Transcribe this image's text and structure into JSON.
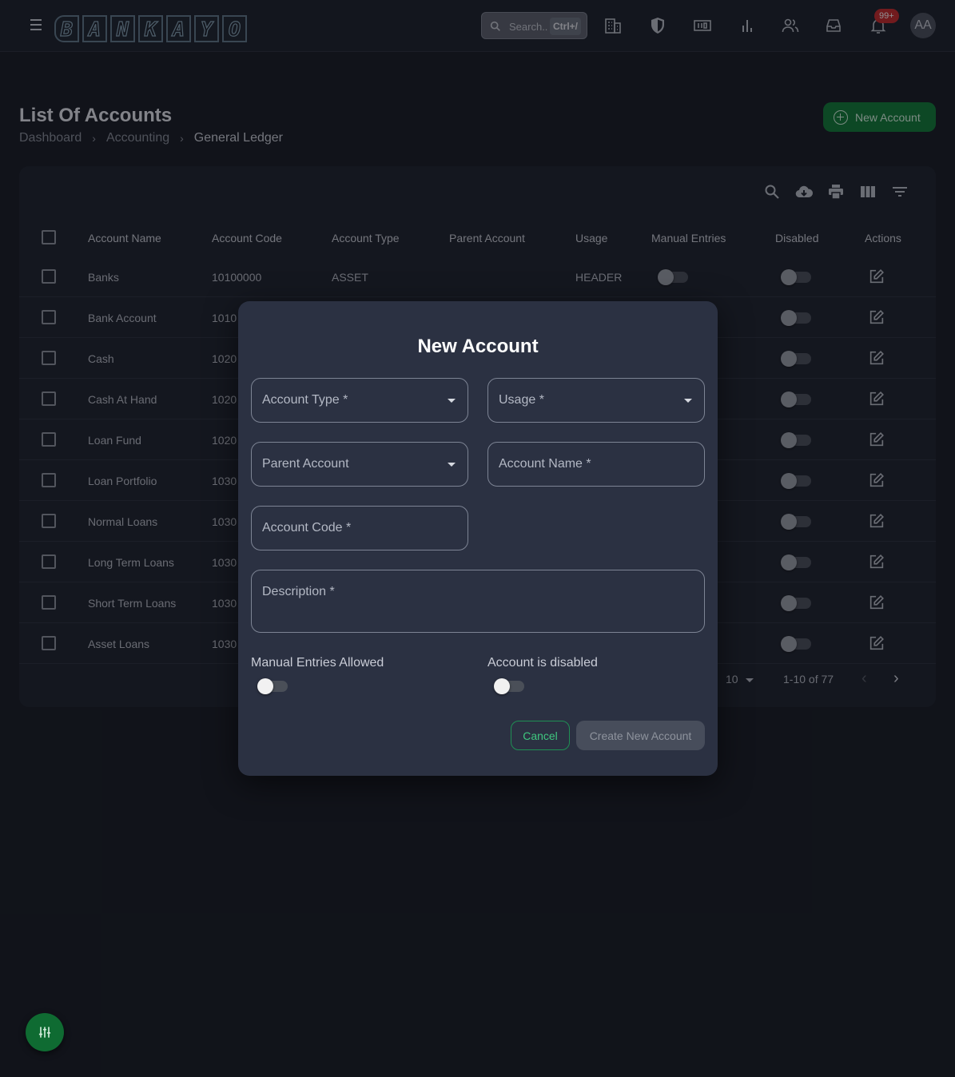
{
  "app": {
    "logo_letters": [
      "B",
      "A",
      "N",
      "K",
      "A",
      "Y",
      "O"
    ],
    "search_placeholder": "Search..",
    "search_shortcut": "Ctrl+/",
    "notifications_badge": "99+",
    "avatar_initials": "AA"
  },
  "page": {
    "title": "List Of Accounts",
    "breadcrumb": [
      "Dashboard",
      "Accounting",
      "General Ledger"
    ],
    "new_account_label": "New Account"
  },
  "table": {
    "columns": [
      "Account Name",
      "Account Code",
      "Account Type",
      "Parent Account",
      "Usage",
      "Manual Entries",
      "Disabled",
      "Actions"
    ],
    "rows": [
      {
        "name": "Banks",
        "code": "10100000",
        "type": "ASSET",
        "parent": "",
        "usage": "HEADER"
      },
      {
        "name": "Bank Account",
        "code": "1010",
        "type": "",
        "parent": "",
        "usage": ""
      },
      {
        "name": "Cash",
        "code": "1020",
        "type": "",
        "parent": "",
        "usage": ""
      },
      {
        "name": "Cash At Hand",
        "code": "1020",
        "type": "",
        "parent": "",
        "usage": ""
      },
      {
        "name": "Loan Fund",
        "code": "1020",
        "type": "",
        "parent": "",
        "usage": ""
      },
      {
        "name": "Loan Portfolio",
        "code": "1030",
        "type": "",
        "parent": "",
        "usage": ""
      },
      {
        "name": "Normal Loans",
        "code": "1030",
        "type": "",
        "parent": "",
        "usage": ""
      },
      {
        "name": "Long Term Loans",
        "code": "1030",
        "type": "",
        "parent": "",
        "usage": ""
      },
      {
        "name": "Short Term Loans",
        "code": "1030",
        "type": "",
        "parent": "",
        "usage": ""
      },
      {
        "name": "Asset Loans",
        "code": "1030",
        "type": "",
        "parent": "",
        "usage": ""
      }
    ],
    "rows_per_page": "10",
    "range_text": "1-10 of 77"
  },
  "dialog": {
    "title": "New Account",
    "account_type_label": "Account Type *",
    "usage_label": "Usage *",
    "parent_account_label": "Parent Account",
    "account_name_label": "Account Name *",
    "account_code_label": "Account Code *",
    "description_label": "Description *",
    "manual_entries_label": "Manual Entries Allowed",
    "disabled_label": "Account is disabled",
    "cancel_label": "Cancel",
    "create_label": "Create New Account"
  }
}
